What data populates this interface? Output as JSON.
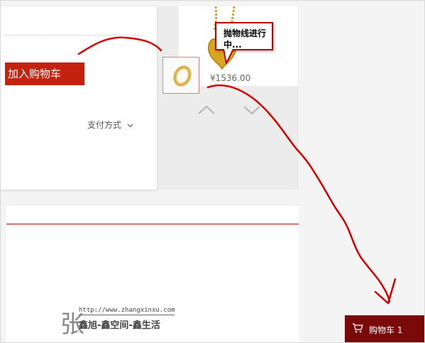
{
  "product": {
    "add_to_cart_label": "加入购物车",
    "pay_method_label": "支付方式",
    "price": "¥1536.00"
  },
  "tooltip": {
    "line1": "抛物线进行",
    "line2": "中..."
  },
  "cart_bar": {
    "label": "购物车 1"
  },
  "watermark": {
    "char": "张",
    "url": "http://www.zhangxinxu.com",
    "slogan": "鑫旭-鑫空间-鑫生活"
  },
  "colors": {
    "accent_red": "#c4210f",
    "annotation_red": "#c00000",
    "cart_bar_bg": "#7a0a0a"
  },
  "icons": {
    "chevron": "chevron-down-icon",
    "cart": "cart-icon",
    "up": "arrow-up-icon",
    "down": "arrow-down-icon"
  }
}
